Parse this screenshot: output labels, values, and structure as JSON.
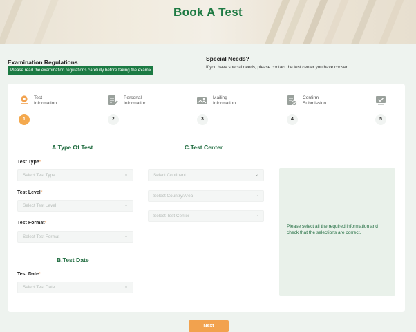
{
  "hero": {
    "title": "Book A Test"
  },
  "regulations": {
    "title": "Examination Regulations",
    "banner": "Please read the examination regulations carefully before taking the exam>"
  },
  "special_needs": {
    "title": "Special Needs?",
    "text": "If you have special needs, please contact the test center you have chosen"
  },
  "steps": [
    {
      "num": "1",
      "label": "Test\nInformation",
      "icon": "location-pin-icon",
      "active": true
    },
    {
      "num": "2",
      "label": "Personal\nInformation",
      "icon": "document-edit-icon",
      "active": false
    },
    {
      "num": "3",
      "label": "Mailing\nInformation",
      "icon": "image-mail-icon",
      "active": false
    },
    {
      "num": "4",
      "label": "Confirm\nSubmission",
      "icon": "document-check-icon",
      "active": false
    },
    {
      "num": "5",
      "label": "",
      "icon": "monitor-check-icon",
      "active": false
    }
  ],
  "section_a": {
    "title": "A.Type Of Test",
    "test_type": {
      "label": "Test Type",
      "req": "*",
      "placeholder": "Select Test Type"
    },
    "test_level": {
      "label": "Test Level",
      "req": "*",
      "placeholder": "Select Test Level"
    },
    "test_format": {
      "label": "Test Format",
      "req": "*",
      "placeholder": "Select Test Format"
    }
  },
  "section_b": {
    "title": "B.Test Date",
    "test_date": {
      "label": "Test Date",
      "req": "*",
      "placeholder": "Select Test Date"
    }
  },
  "section_c": {
    "title": "C.Test Center",
    "continent": {
      "placeholder": "Select Continent"
    },
    "country": {
      "placeholder": "Select Country/Area"
    },
    "center": {
      "placeholder": "Select Test Center"
    }
  },
  "info": {
    "text": "Please select all the required information and check that the selections are correct."
  },
  "next_button": {
    "label": "Next"
  },
  "colors": {
    "brand_green": "#1b7a43",
    "accent_orange": "#f2a24e"
  }
}
